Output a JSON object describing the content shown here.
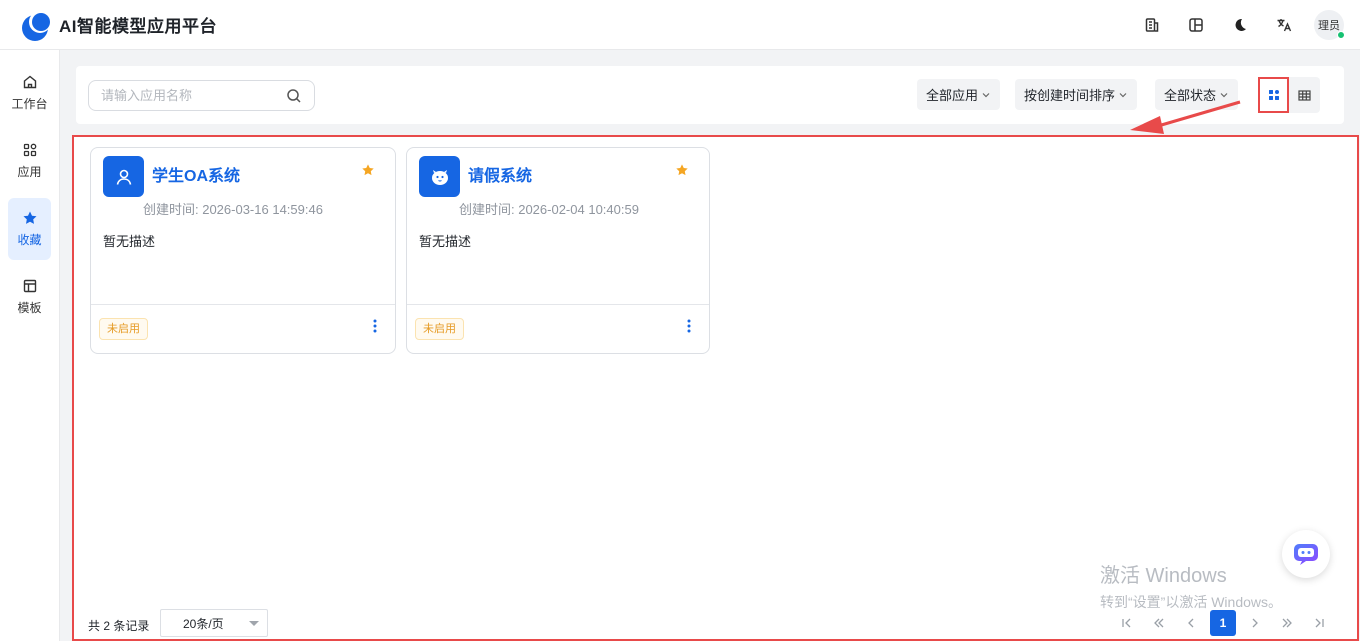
{
  "header": {
    "app_title": "AI智能模型应用平台",
    "icons": [
      "building-icon",
      "layout-icon",
      "moon-icon",
      "translate-icon"
    ],
    "avatar_text": "理员",
    "online_color": "#16c172"
  },
  "sidebar": {
    "items": [
      {
        "label": "工作台",
        "icon": "home-icon",
        "active": false
      },
      {
        "label": "应用",
        "icon": "apps-icon",
        "active": false
      },
      {
        "label": "收藏",
        "icon": "star-icon",
        "active": true
      },
      {
        "label": "模板",
        "icon": "template-icon",
        "active": false
      }
    ]
  },
  "toolbar": {
    "search_placeholder": "请输入应用名称",
    "filter_app": "全部应用",
    "sort": "按创建时间排序",
    "filter_status": "全部状态",
    "view_modes": [
      "card-view",
      "table-view"
    ],
    "active_view": "card-view"
  },
  "cards": [
    {
      "name": "学生OA系统",
      "icon": "user-icon",
      "created": "创建时间: 2026-03-16 14:59:46",
      "description": "暂无描述",
      "status": "未启用",
      "favorited": true
    },
    {
      "name": "请假系统",
      "icon": "bot-face-icon",
      "created": "创建时间: 2026-02-04 10:40:59",
      "description": "暂无描述",
      "status": "未启用",
      "favorited": true
    }
  ],
  "pagination": {
    "total_text": "共 2 条记录",
    "page_size": "20条/页",
    "current_page": "1"
  },
  "watermark": {
    "line1": "激活 Windows",
    "line2": "转到“设置”以激活 Windows。"
  },
  "colors": {
    "accent": "#1666e3",
    "highlight": "#e84a4a",
    "star": "#f5a623"
  }
}
